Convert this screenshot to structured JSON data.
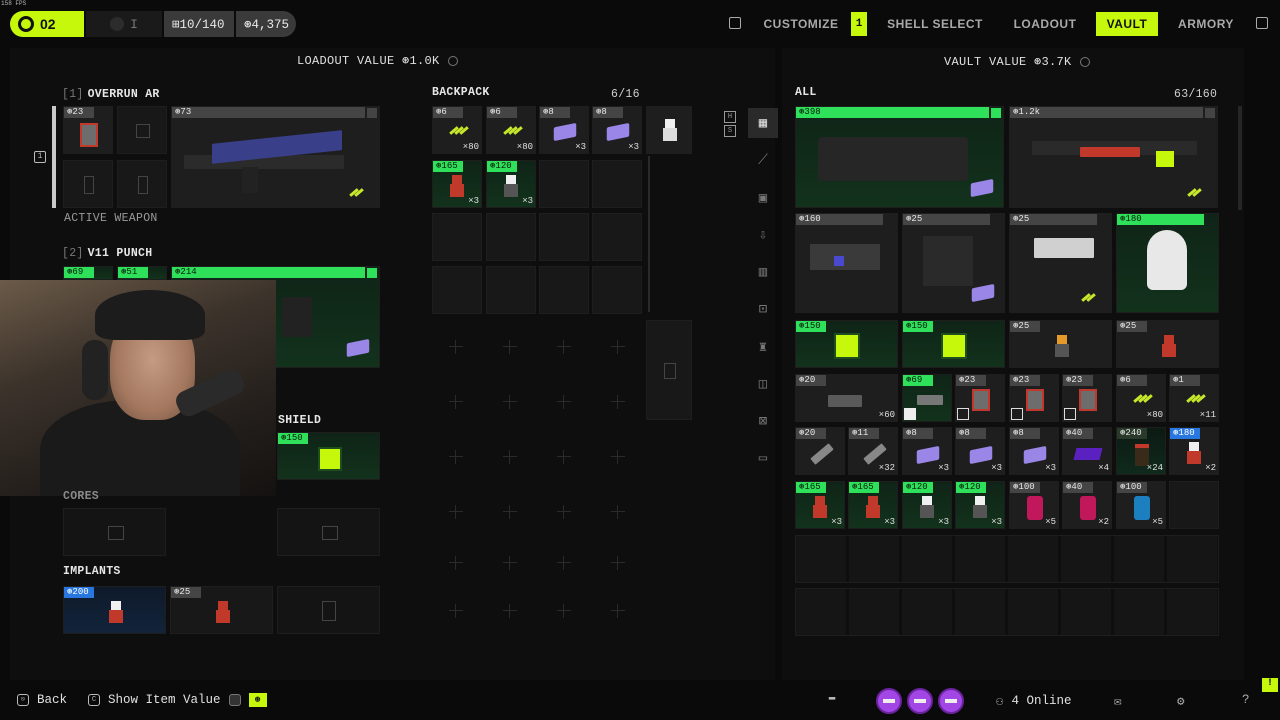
{
  "fps": "158 FPS",
  "top": {
    "level": "02",
    "level_alt": "I",
    "res_a": "⊞10/140",
    "res_b": "⊛4,375",
    "nav": [
      "CUSTOMIZE",
      "SHELL SELECT",
      "LOADOUT",
      "VAULT",
      "ARMORY"
    ],
    "customize_badge": "1",
    "active_tab": "VAULT"
  },
  "loadout": {
    "value_label": "LOADOUT VALUE ⊛1.0K",
    "weapon1": {
      "num": "[1]",
      "name": "OVERRUN AR",
      "mods": [
        "⊛23"
      ],
      "value": "⊛73",
      "active": "ACTIVE WEAPON"
    },
    "weapon2": {
      "num": "[2]",
      "name": "V11 PUNCH",
      "tags": [
        "⊛69",
        "⊛51",
        "⊛214"
      ]
    },
    "shield": {
      "label": "SHIELD",
      "value": "⊛150"
    },
    "cores": "CORES",
    "implants": {
      "label": "IMPLANTS",
      "values": [
        "⊛200",
        "⊛25"
      ]
    },
    "slot_key": "1"
  },
  "backpack": {
    "label": "BACKPACK",
    "count": "6/16",
    "items": [
      {
        "tag": "⊛6",
        "qty": "×80",
        "kind": "ammo"
      },
      {
        "tag": "⊛6",
        "qty": "×80",
        "kind": "ammo"
      },
      {
        "tag": "⊛8",
        "qty": "×3",
        "kind": "plate"
      },
      {
        "tag": "⊛8",
        "qty": "×3",
        "kind": "plate"
      },
      {
        "tag": "⊛165",
        "qty": "×3",
        "kind": "redbot"
      },
      {
        "tag": "⊛120",
        "qty": "×3",
        "kind": "whitebot"
      }
    ]
  },
  "vault": {
    "value_label": "VAULT VALUE ⊛3.7K",
    "all": "ALL",
    "count": "63/160",
    "big": [
      {
        "tag": "⊛398"
      },
      {
        "tag": "⊛1.2k"
      }
    ],
    "row2": [
      "⊛160",
      "⊛25",
      "⊛25",
      "⊛180"
    ],
    "row3": [
      "⊛150",
      "⊛150",
      "⊛25",
      "⊛25"
    ],
    "row4": [
      {
        "tag": "⊛20",
        "qty": "×60"
      },
      {
        "tag": "⊛69",
        "qty": ""
      },
      {
        "tag": "⊛23",
        "qty": ""
      },
      {
        "tag": "⊛23",
        "qty": ""
      },
      {
        "tag": "⊛23",
        "qty": ""
      },
      {
        "tag": "⊛6",
        "qty": "×80"
      },
      {
        "tag": "⊛1",
        "qty": "×11"
      }
    ],
    "row5": [
      {
        "tag": "⊛20",
        "qty": ""
      },
      {
        "tag": "⊛11",
        "qty": "×32"
      },
      {
        "tag": "⊛8",
        "qty": "×3"
      },
      {
        "tag": "⊛8",
        "qty": "×3"
      },
      {
        "tag": "⊛8",
        "qty": "×3"
      },
      {
        "tag": "⊛40",
        "qty": "×4"
      },
      {
        "tag": "⊛240",
        "qty": "×24"
      },
      {
        "tag": "⊛180",
        "qty": "×2"
      }
    ],
    "row6": [
      {
        "tag": "⊛165",
        "qty": "×3"
      },
      {
        "tag": "⊛165",
        "qty": "×3"
      },
      {
        "tag": "⊛120",
        "qty": "×3"
      },
      {
        "tag": "⊛120",
        "qty": "×3"
      },
      {
        "tag": "⊛100",
        "qty": "×5"
      },
      {
        "tag": "⊛40",
        "qty": "×2"
      },
      {
        "tag": "⊛100",
        "qty": "×5"
      }
    ]
  },
  "bottom": {
    "back": "Back",
    "show_value": "Show Item Value",
    "online": "4 Online"
  },
  "colors": {
    "accent": "#c6f80b",
    "green_tag": "#2ee05a",
    "blue_tag": "#2877e0"
  }
}
